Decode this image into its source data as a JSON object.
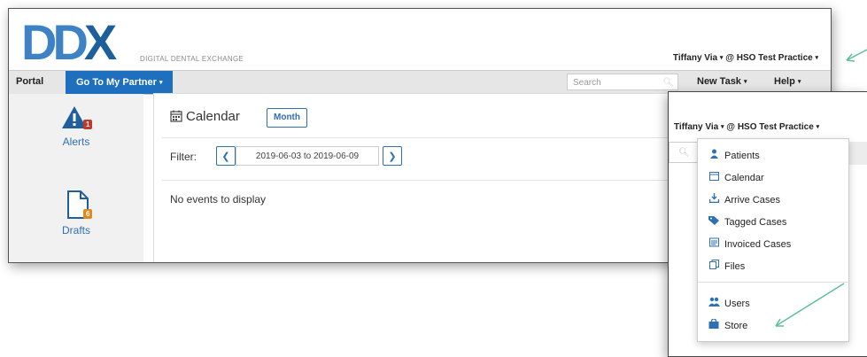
{
  "header": {
    "logo_text": "DDX",
    "logo_subtitle": "DIGITAL DENTAL EXCHANGE",
    "user_label": "Tiffany Via",
    "practice_label": "@ HSO Test Practice"
  },
  "nav": {
    "portal": "Portal",
    "partner": "Go To My Partner",
    "search_placeholder": "Search",
    "new_task": "New Task",
    "help": "Help"
  },
  "sidebar": {
    "items": [
      {
        "label": "Alerts",
        "badge": "1",
        "icon": "alert-triangle-icon",
        "badge_color": "#c0392b"
      },
      {
        "label": "Drafts",
        "badge": "6",
        "icon": "document-icon",
        "badge_color": "#e08a1e"
      }
    ]
  },
  "calendar": {
    "title": "Calendar",
    "view_button": "Month",
    "filter_label": "Filter:",
    "date_range": "2019-06-03 to 2019-06-09",
    "empty_message": "No events to display"
  },
  "dropdown": {
    "user_label": "Tiffany Via",
    "practice_label": "@ HSO Test Practice",
    "items": [
      {
        "label": "Patients",
        "icon": "patient-icon"
      },
      {
        "label": "Calendar",
        "icon": "calendar-icon"
      },
      {
        "label": "Arrive Cases",
        "icon": "arrive-icon"
      },
      {
        "label": "Tagged Cases",
        "icon": "tag-icon"
      },
      {
        "label": "Invoiced Cases",
        "icon": "invoice-icon"
      },
      {
        "label": "Files",
        "icon": "files-icon"
      },
      {
        "label": "Users",
        "icon": "users-icon"
      },
      {
        "label": "Store",
        "icon": "store-icon"
      }
    ]
  },
  "colors": {
    "brand_blue": "#1f6fbf",
    "link_blue": "#2f6fb3",
    "annotation_arrow": "#5fbf9a"
  }
}
